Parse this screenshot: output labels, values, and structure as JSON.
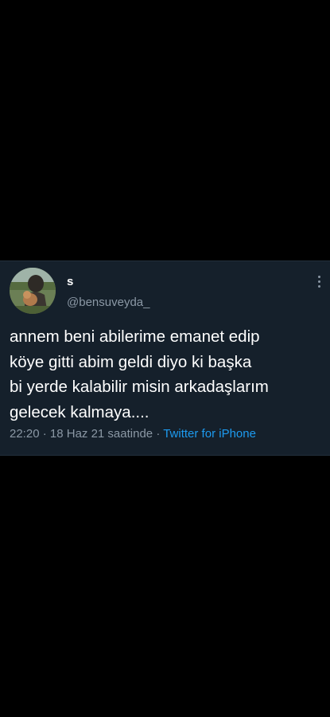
{
  "tweet": {
    "display_name": "s",
    "handle": "@bensuveyda_",
    "text": "annem beni abilerime emanet edip\nköye gitti abim geldi diyo ki başka\nbi yerde kalabilir misin arkadaşlarım\ngelecek kalmaya....",
    "time": "22:20",
    "separator": " · ",
    "date": "18 Haz 21 saatinde",
    "source": "Twitter for iPhone"
  },
  "icons": {
    "avatar": "profile-photo",
    "more": "more-vertical-icon"
  },
  "colors": {
    "background": "#000000",
    "card": "#15202b",
    "text": "#ffffff",
    "secondary": "#8b98a5",
    "link": "#1d9bf0"
  }
}
